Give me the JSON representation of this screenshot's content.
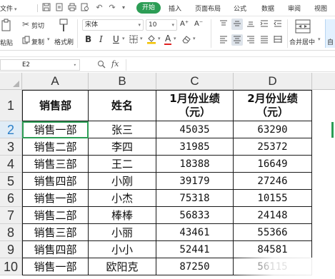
{
  "menubar": {
    "file_label": "文件",
    "tabs": [
      "开始",
      "插入",
      "页面布局",
      "公式",
      "数据",
      "审阅",
      "视图"
    ],
    "active_tab": "开始"
  },
  "ribbon": {
    "paste_label": "粘贴",
    "cut_label": "剪切",
    "copy_label": "复制",
    "format_painter_label": "格式刷",
    "font_name": "宋体",
    "font_size": "10",
    "bold_label": "B",
    "italic_label": "I",
    "underline_label": "U",
    "font_color_label": "A",
    "grow_font_label": "A⁺",
    "shrink_font_label": "A⁻",
    "merge_center_label": "合并居中",
    "auto_wrap_label": "自"
  },
  "formula_bar": {
    "cell_ref": "E2",
    "fx_label": "fx",
    "formula": ""
  },
  "sheet": {
    "columns": [
      "A",
      "B",
      "C",
      "D"
    ],
    "row_numbers": [
      "1",
      "2",
      "3",
      "4",
      "5",
      "6",
      "7",
      "8",
      "9",
      "10"
    ],
    "selected_row": "2",
    "header": {
      "a": "销售部",
      "b": "姓名",
      "c_line1": "1月份业绩",
      "c_line2": "（元）",
      "d_line1": "2月份业绩",
      "d_line2": "（元）"
    },
    "rows": [
      {
        "dept": "销售一部",
        "name": "张三",
        "jan": "45035",
        "feb": "63290"
      },
      {
        "dept": "销售二部",
        "name": "李四",
        "jan": "31985",
        "feb": "25372"
      },
      {
        "dept": "销售三部",
        "name": "王二",
        "jan": "18388",
        "feb": "16649"
      },
      {
        "dept": "销售四部",
        "name": "小刚",
        "jan": "39179",
        "feb": "27246"
      },
      {
        "dept": "销售一部",
        "name": "小杰",
        "jan": "75318",
        "feb": "10155"
      },
      {
        "dept": "销售二部",
        "name": "棒棒",
        "jan": "56833",
        "feb": "24148"
      },
      {
        "dept": "销售三部",
        "name": "小丽",
        "jan": "43461",
        "feb": "55366"
      },
      {
        "dept": "销售四部",
        "name": "小小",
        "jan": "52441",
        "feb": "84581"
      },
      {
        "dept": "销售一部",
        "name": "欧阳克",
        "jan": "87250",
        "feb": "56115"
      }
    ]
  },
  "colors": {
    "accent_green": "#2c9d55",
    "selected_row_header": "#e0ecf6"
  }
}
